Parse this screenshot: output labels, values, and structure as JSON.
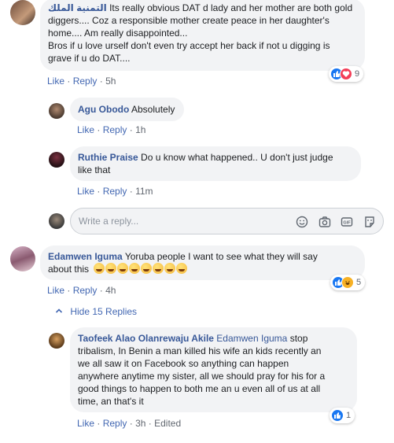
{
  "comments": [
    {
      "author": "التمنية الملك",
      "lines": [
        "Its really obvious DAT d lady and her mother are both gold",
        "diggers.... Coz a responsible mother create peace in her daughter's",
        "home.... Am really disappointed...",
        "Bros if u love urself don't even try accept her back if not u digging is",
        "grave if u do DAT...."
      ],
      "like": "Like",
      "reply": "Reply",
      "time": "5h",
      "reactions": "9"
    },
    {
      "author": "Agu Obodo",
      "text": "Absolutely",
      "like": "Like",
      "reply": "Reply",
      "time": "1h"
    },
    {
      "author": "Ruthie Praise",
      "line1": "Do u know what happened.. U don't just judge",
      "line2": "like that",
      "like": "Like",
      "reply": "Reply",
      "time": "11m"
    },
    {
      "author": "Edamwen Iguma",
      "line1": "Yoruba people I want to see what they will say",
      "line2": "about this",
      "like": "Like",
      "reply": "Reply",
      "time": "4h",
      "reactions": "5",
      "hide_replies": "Hide 15 Replies"
    },
    {
      "author": "Taofeek Alao Olanrewaju Akile",
      "mention": "Edamwen Iguma",
      "line1_rest": "stop",
      "lines": [
        "tribalism, In Benin a man killed his wife an kids recently an",
        "we all saw it on Facebook so anything can happen",
        "anywhere anytime my sister, all we should pray for his for a",
        "good things to happen to both me an u even all of us at all",
        "time, an that's it"
      ],
      "like": "Like",
      "reply": "Reply",
      "time": "3h",
      "edited": "Edited",
      "reactions": "1"
    }
  ],
  "reply_box": {
    "placeholder": "Write a reply..."
  },
  "separator": "·",
  "icons": [
    "emoji-icon",
    "camera-icon",
    "gif-icon",
    "sticker-icon"
  ],
  "colors": {
    "link": "#385898",
    "action": "#4267b2",
    "like": "#1877f2",
    "love": "#f33e58",
    "bubble": "#f2f3f5"
  }
}
